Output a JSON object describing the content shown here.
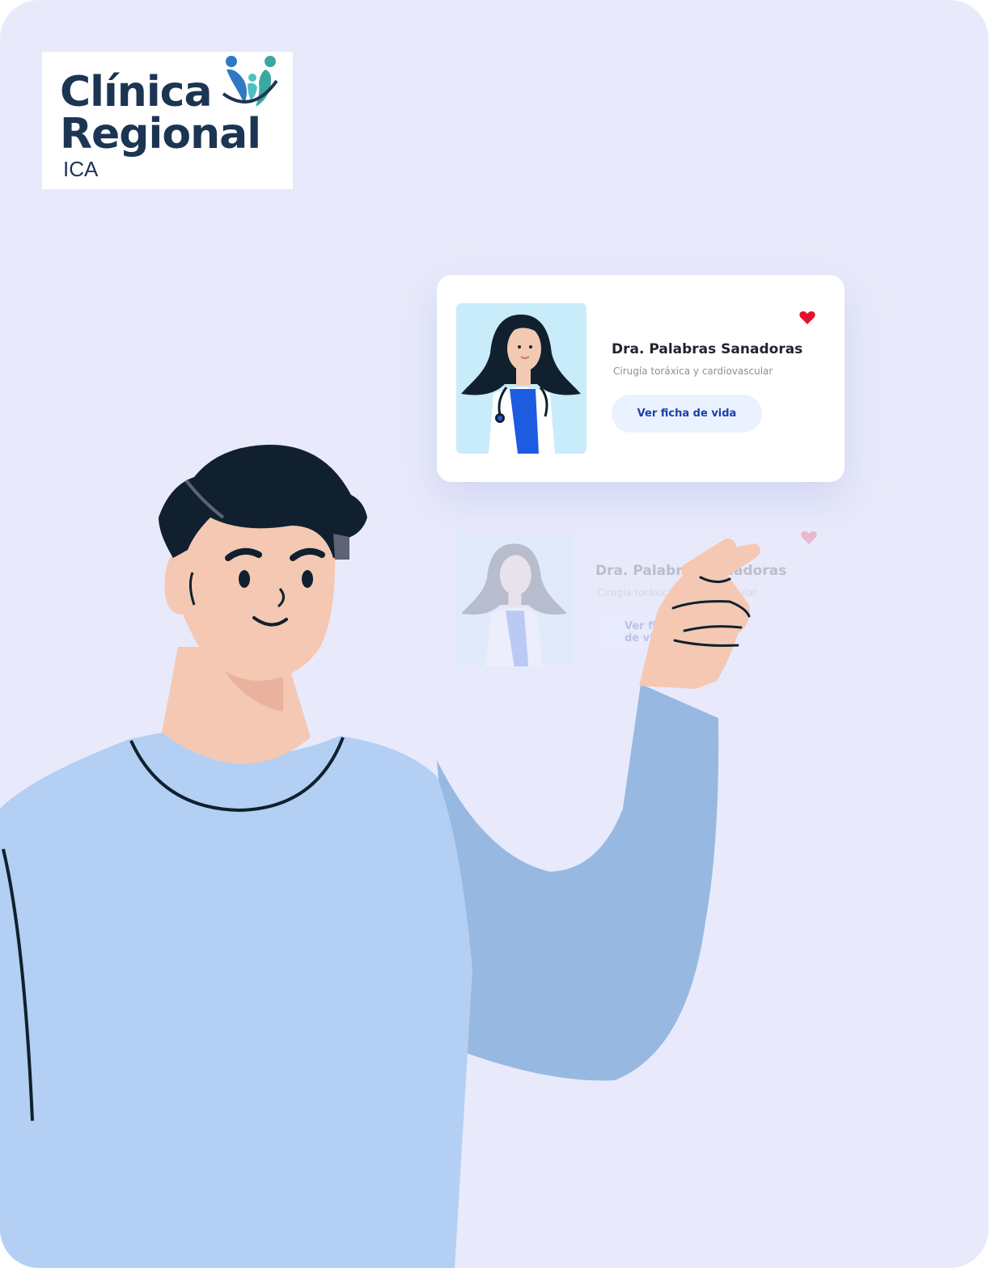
{
  "logo": {
    "line1": "Clínica",
    "line2": "Regional",
    "line3": "ICA"
  },
  "doctor_card": {
    "name": "Dra. Palabras Sanadoras",
    "specialty": "Cirugía toráxica y cardiovascular",
    "button_label": "Ver ficha de vida",
    "heart_color": "#e8112d"
  },
  "ghost_card": {
    "name": "Dra. Palabras Sanadoras",
    "specialty": "Cirugía toráxica y cardiovascular",
    "button_label": "Ver ficha de vida"
  },
  "colors": {
    "background": "#e8eafb",
    "brand_navy": "#1c3553",
    "brand_teal": "#3aa7a0",
    "brand_blue": "#2f78c4"
  }
}
